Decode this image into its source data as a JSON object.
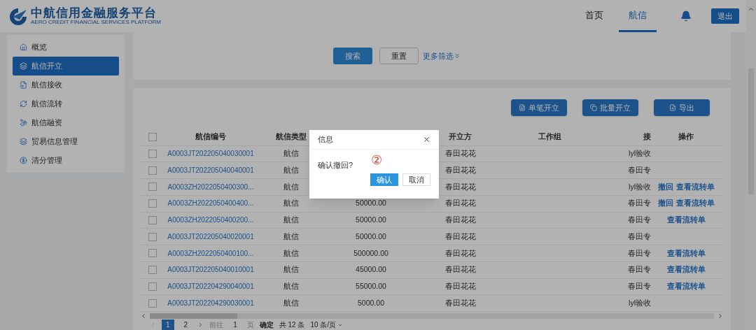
{
  "header": {
    "logo_title": "中航信用金融服务平台",
    "logo_subtitle": "AERO CREDIT FINANCIAL SERVICES PLATFORM",
    "nav": [
      {
        "label": "首页",
        "selected": false
      },
      {
        "label": "航信",
        "selected": true
      }
    ],
    "logout": "退出"
  },
  "sidebar": {
    "items": [
      {
        "label": "概览",
        "selected": false
      },
      {
        "label": "航信开立",
        "selected": true
      },
      {
        "label": "航信接收",
        "selected": false
      },
      {
        "label": "航信流转",
        "selected": false
      },
      {
        "label": "航信融资",
        "selected": false
      },
      {
        "label": "贸易信息管理",
        "selected": false
      },
      {
        "label": "清分管理",
        "selected": false
      }
    ]
  },
  "search": {
    "search_button": "搜索",
    "reset_button": "重置",
    "more_filters": "更多筛选"
  },
  "toolbar": [
    {
      "label": "单笔开立"
    },
    {
      "label": "批量开立"
    },
    {
      "label": "导出"
    }
  ],
  "table": {
    "select_all_checked": false,
    "columns": [
      "航信编号",
      "航信类型",
      "开立方",
      "工作组",
      "接",
      "操作"
    ],
    "rows": [
      {
        "checked": false,
        "id": "A0003JT202205040030001",
        "type": "航信",
        "issuer": "春田花花",
        "receiver": "lyl验收",
        "actions": []
      },
      {
        "checked": false,
        "id": "A0003JT202205040040001",
        "type": "航信",
        "issuer": "春田花花",
        "receiver": "春田专",
        "actions": []
      },
      {
        "checked": false,
        "id": "A0003ZH2022050400300...",
        "type": "航信",
        "issuer": "春田花花",
        "receiver": "lyl验收",
        "actions": [
          "撤回",
          "查看流转单"
        ]
      },
      {
        "checked": false,
        "id": "A0003ZH2022050400400...",
        "type": "航信",
        "amount": "50000.00",
        "issuer": "春田花花",
        "receiver": "春田专",
        "actions": [
          "撤回",
          "查看流转单"
        ]
      },
      {
        "checked": false,
        "id": "A0003ZH2022050400200...",
        "type": "航信",
        "amount": "50000.00",
        "issuer": "春田花花",
        "receiver": "春田专",
        "actions": [
          "查看流转单"
        ]
      },
      {
        "checked": false,
        "id": "A0003JT202205040020001",
        "type": "航信",
        "amount": "50000.00",
        "issuer": "春田花花",
        "receiver": "春田专",
        "actions": []
      },
      {
        "checked": false,
        "id": "A0003ZH2022050400100...",
        "type": "航信",
        "amount": "500000.00",
        "issuer": "春田花花",
        "receiver": "春田专",
        "actions": [
          "查看流转单"
        ]
      },
      {
        "checked": false,
        "id": "A0003JT202205040010001",
        "type": "航信",
        "amount": "45000.00",
        "issuer": "春田花花",
        "receiver": "春田专",
        "actions": [
          "查看流转单"
        ]
      },
      {
        "checked": false,
        "id": "A0003JT202204290040001",
        "type": "航信",
        "amount": "55000.00",
        "issuer": "春田花花",
        "receiver": "春田专",
        "actions": [
          "查看流转单"
        ]
      },
      {
        "checked": false,
        "id": "A0003JT202204290030001",
        "type": "航信",
        "amount": "5000.00",
        "issuer": "春田花花",
        "receiver": "lyl验收",
        "actions": []
      }
    ]
  },
  "pagination": {
    "pages": [
      {
        "label": "1",
        "selected": true
      },
      {
        "label": "2",
        "selected": false
      }
    ],
    "goto": "前往",
    "page_input": "1",
    "page_unit": "页",
    "confirm": "确定",
    "total": "共 12 条",
    "page_size": "10 条/页"
  },
  "dialog": {
    "title": "信息",
    "message": "确认撤回?",
    "annotation": "②",
    "confirm": "确认",
    "cancel": "取消"
  }
}
